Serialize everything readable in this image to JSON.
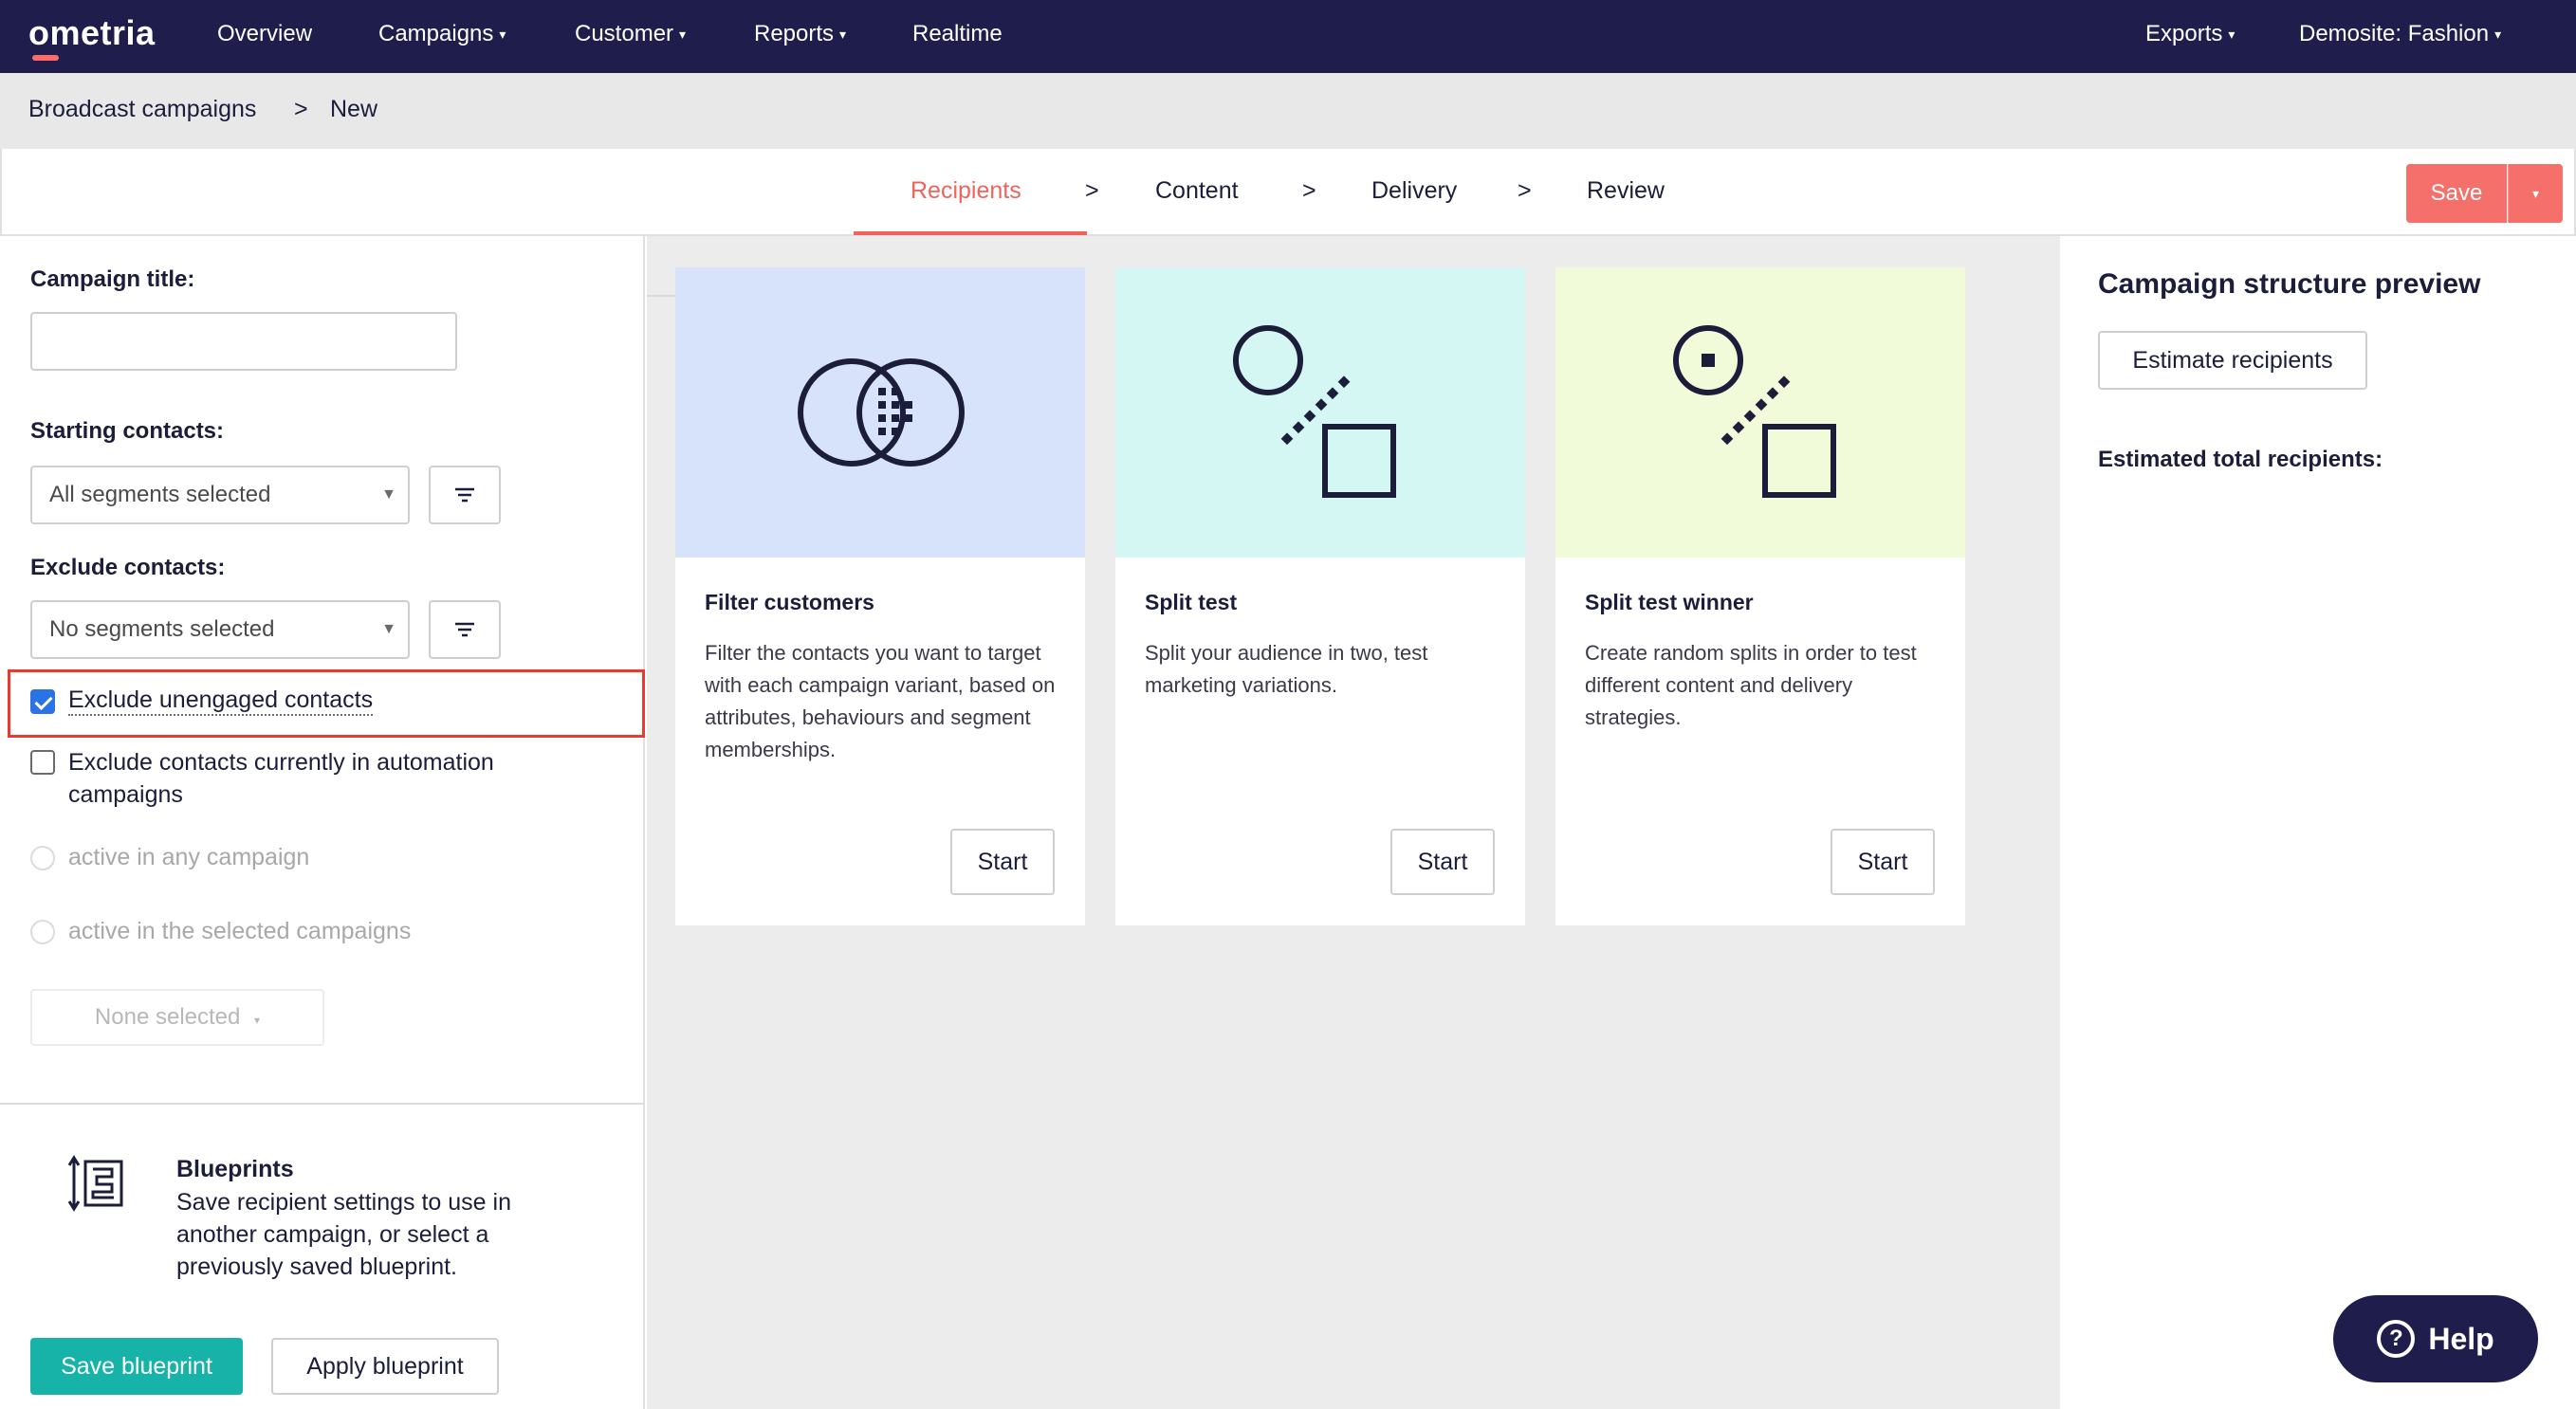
{
  "nav": {
    "logo": "ometria",
    "items": [
      "Overview",
      "Campaigns",
      "Customer",
      "Reports",
      "Realtime"
    ],
    "exports": "Exports",
    "site": "Demosite: Fashion"
  },
  "breadcrumb": {
    "parent": "Broadcast campaigns",
    "separator": ">",
    "current": "New"
  },
  "steps": {
    "items": [
      "Recipients",
      "Content",
      "Delivery",
      "Review"
    ],
    "separator": ">",
    "active": "Recipients",
    "save_label": "Save"
  },
  "left": {
    "title_label": "Campaign title:",
    "title_value": "",
    "starting_label": "Starting contacts:",
    "starting_value": "All segments selected",
    "exclude_label": "Exclude contacts:",
    "exclude_value": "No segments selected",
    "exclude_unengaged": "Exclude unengaged contacts",
    "exclude_automation": "Exclude contacts currently in automation campaigns",
    "radio_any": "active in any campaign",
    "radio_selected": "active in the selected campaigns",
    "none_selected": "None selected",
    "blueprints_title": "Blueprints",
    "blueprints_desc": "Save recipient settings to use in another campaign, or select a previously saved blueprint.",
    "save_blueprint": "Save blueprint",
    "apply_blueprint": "Apply blueprint"
  },
  "cards": [
    {
      "title": "Filter customers",
      "desc": "Filter the contacts you want to target with each campaign variant, based on attributes, behaviours and segment memberships.",
      "button": "Start",
      "bg": "#d6e3fb"
    },
    {
      "title": "Split test",
      "desc": "Split your audience in two, test marketing variations.",
      "button": "Start",
      "bg": "#d4f7f4"
    },
    {
      "title": "Split test winner",
      "desc": "Create random splits in order to test different content and delivery strategies.",
      "button": "Start",
      "bg": "#f2fbd9"
    }
  ],
  "right": {
    "title": "Campaign structure preview",
    "estimate_button": "Estimate recipients",
    "estimated_label": "Estimated total recipients:"
  },
  "help": "Help",
  "colors": {
    "nav_bg": "#1f1d4c",
    "accent": "#f0625e",
    "teal": "#17b3a8",
    "highlight": "#e83a2e"
  }
}
